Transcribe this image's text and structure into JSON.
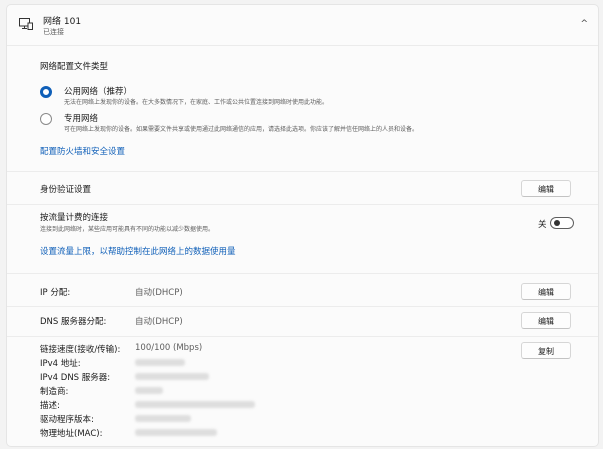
{
  "header": {
    "title": "网络 101",
    "status": "已连接",
    "icon": "monitor-network-icon",
    "chevron": "^"
  },
  "profile": {
    "heading": "网络配置文件类型",
    "public": {
      "label": "公用网络（推荐）",
      "desc": "无法在网络上发现你的设备。在大多数情况下，在家庭、工作或公共位置连接到网络时使用此功能。",
      "selected": true
    },
    "private": {
      "label": "专用网络",
      "desc": "可在网络上发现你的设备。如果需要文件共享或使用通过此网络通信的应用，请选择此选项。你应该了解并信任网络上的人员和设备。",
      "selected": false
    },
    "firewall_link": "配置防火墙和安全设置"
  },
  "auth": {
    "label": "身份验证设置",
    "button": "编辑"
  },
  "metered": {
    "label": "按流量计费的连接",
    "desc": "连接到此网络时，某些应用可能具有不同的功能以减少数据使用。",
    "toggle_text": "关",
    "toggle_on": false,
    "link": "设置流量上限，以帮助控制在此网络上的数据使用量"
  },
  "ip": {
    "label": "IP 分配:",
    "value": "自动(DHCP)",
    "button": "编辑"
  },
  "dns": {
    "label": "DNS 服务器分配:",
    "value": "自动(DHCP)",
    "button": "编辑"
  },
  "details": {
    "copy_button": "复制",
    "link_speed_label": "链接速度(接收/传输):",
    "link_speed_value": "100/100 (Mbps)",
    "ipv4_label": "IPv4 地址:",
    "ipv4_dns_label": "IPv4 DNS 服务器:",
    "manufacturer_label": "制造商:",
    "description_label": "描述:",
    "driver_label": "驱动程序版本:",
    "mac_label": "物理地址(MAC):"
  },
  "colors": {
    "accent": "#0f5fb8",
    "background": "#f3f3f3",
    "panel": "#fbfbfb"
  }
}
